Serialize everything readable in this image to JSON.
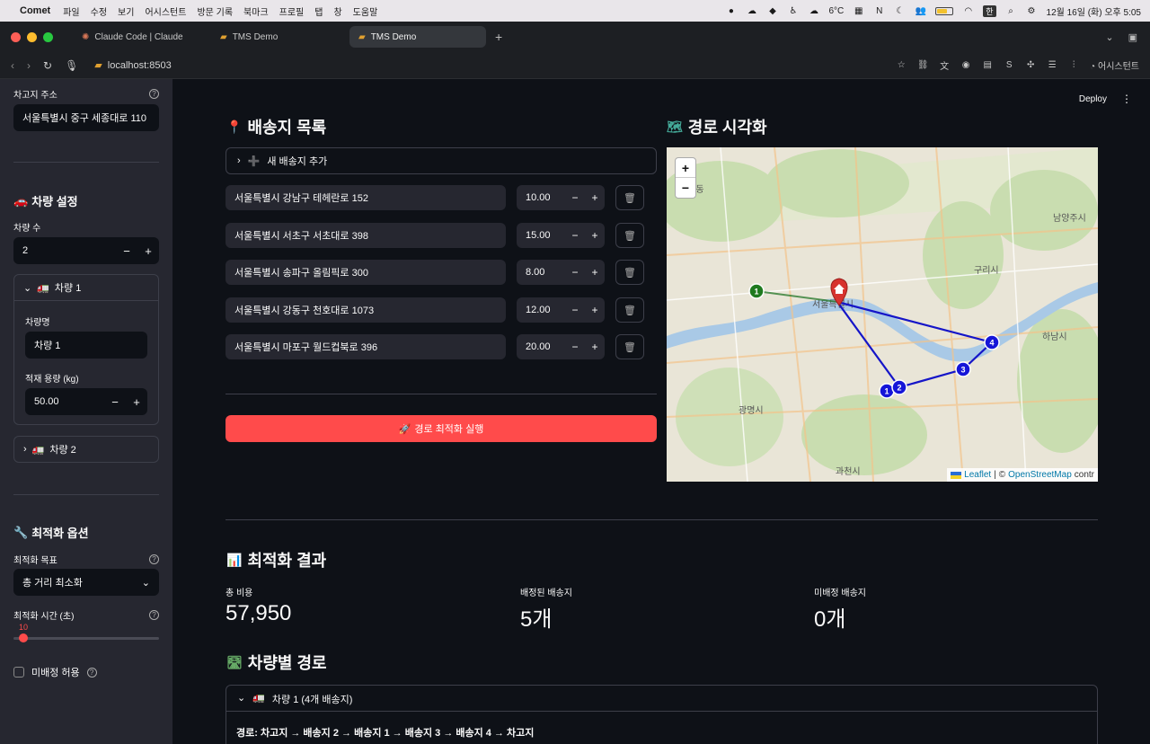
{
  "os_menu": {
    "app_name": "Comet",
    "items": [
      "파일",
      "수정",
      "보기",
      "어시스턴트",
      "방문 기록",
      "북마크",
      "프로필",
      "탭",
      "창",
      "도움말"
    ],
    "weather": "6°C",
    "datetime": "12월 16일 (화) 오후 5:05",
    "input_method": "한"
  },
  "browser": {
    "tabs": [
      {
        "label": "Claude Code | Claude",
        "active": false
      },
      {
        "label": "TMS Demo",
        "active": false
      },
      {
        "label": "TMS Demo",
        "active": true
      }
    ],
    "url": "localhost:8503",
    "assistant_label": "어시스턴트"
  },
  "sidebar": {
    "depot_label": "차고지 주소",
    "depot_value": "서울특별시 중구 세종대로 110",
    "vehicle_section": "차량 설정",
    "vehicle_count_label": "차량 수",
    "vehicle_count": "2",
    "vehicle1": {
      "title": "차량 1",
      "name_label": "차량명",
      "name_value": "차량 1",
      "capacity_label": "적재 용량 (kg)",
      "capacity_value": "50.00"
    },
    "vehicle2_title": "차량 2",
    "opt_section": "최적화 옵션",
    "objective_label": "최적화 목표",
    "objective_value": "총 거리 최소화",
    "time_label": "최적화 시간 (초)",
    "time_value": "10",
    "time_fraction": 0.05,
    "unassigned_label": "미배정 허용"
  },
  "main": {
    "deploy_label": "Deploy",
    "delivery_title": "배송지 목록",
    "add_delivery_label": "새 배송지 추가",
    "deliveries": [
      {
        "address": "서울특별시 강남구 테헤란로 152",
        "qty": "10.00"
      },
      {
        "address": "서울특별시 서초구 서초대로 398",
        "qty": "15.00"
      },
      {
        "address": "서울특별시 송파구 올림픽로 300",
        "qty": "8.00"
      },
      {
        "address": "서울특별시 강동구 천호대로 1073",
        "qty": "12.00"
      },
      {
        "address": "서울특별시 마포구 월드컵북로 396",
        "qty": "20.00"
      }
    ],
    "run_button": "경로 최적화 실행",
    "map_title": "경로 시각화",
    "map_labels": [
      "서울특별시",
      "구리시",
      "남양주시",
      "하남시",
      "광명시",
      "과천시",
      "진관동"
    ],
    "attribution": {
      "leaflet": "Leaflet",
      "sep": "|",
      "copy": "©",
      "osm": "OpenStreetMap",
      "contrib": "contr"
    },
    "result_title": "최적화 결과",
    "metrics": [
      {
        "label": "총 비용",
        "value": "57,950"
      },
      {
        "label": "배정된 배송지",
        "value": "5개"
      },
      {
        "label": "미배정 배송지",
        "value": "0개"
      }
    ],
    "route_title": "차량별 경로",
    "route_expander": "차량 1 (4개 배송지)",
    "route_text": "경로: 차고지 → 배송지 2 → 배송지 1 → 배송지 3 → 배송지 4 → 차고지"
  }
}
